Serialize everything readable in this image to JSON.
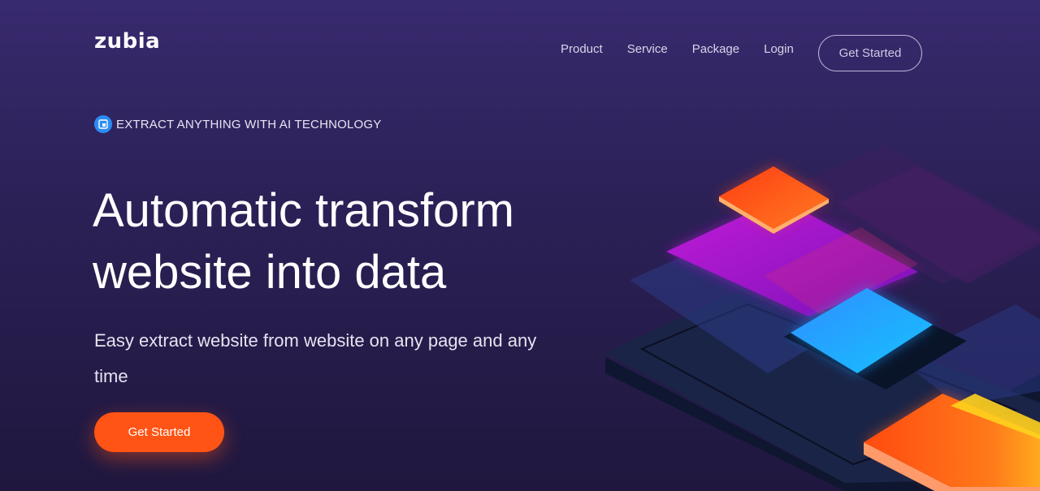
{
  "brand": {
    "name": "zubia"
  },
  "nav": {
    "items": [
      {
        "label": "Product"
      },
      {
        "label": "Service"
      },
      {
        "label": "Package"
      },
      {
        "label": "Login"
      }
    ],
    "cta_label": "Get Started"
  },
  "hero": {
    "badge_icon": "document-scan-icon",
    "badge_text": "EXTRACT ANYTHING WITH AI TECHNOLOGY",
    "title_line1": "Automatic transform",
    "title_line2": "website into data",
    "subtitle": "Easy extract website from website on any page and any time",
    "cta_label": "Get Started"
  },
  "colors": {
    "background_top": "#382a6e",
    "background_bottom": "#1f173e",
    "accent": "#ff5415",
    "badge_blue": "#2a8cf7"
  }
}
